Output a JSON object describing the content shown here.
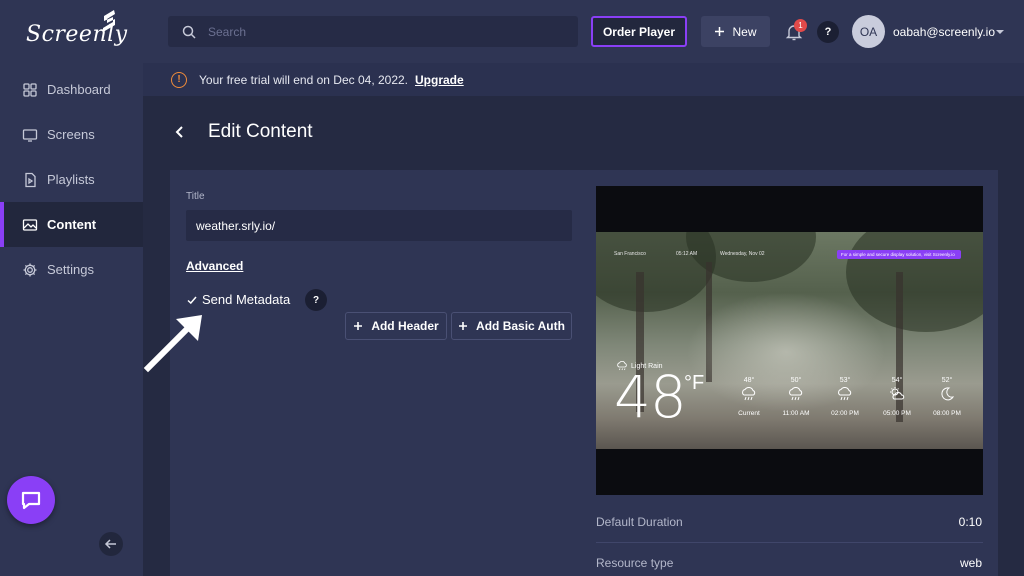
{
  "brand": {
    "name": "Screenly",
    "accent": "#8a3ff6"
  },
  "sidebar": {
    "items": [
      {
        "label": "Dashboard",
        "icon": "grid-icon",
        "active": false
      },
      {
        "label": "Screens",
        "icon": "monitor-icon",
        "active": false
      },
      {
        "label": "Playlists",
        "icon": "playlist-icon",
        "active": false
      },
      {
        "label": "Content",
        "icon": "image-icon",
        "active": true
      },
      {
        "label": "Settings",
        "icon": "gear-icon",
        "active": false
      }
    ]
  },
  "topbar": {
    "search_placeholder": "Search",
    "order_label": "Order Player",
    "new_label": "New",
    "notification_count": "1",
    "help_label": "?",
    "avatar_initials": "OA",
    "user_email": "oabah@screenly.io"
  },
  "banner": {
    "message": "Your free trial will end on Dec 04, 2022.",
    "link": "Upgrade",
    "color": "#f08c3a"
  },
  "page": {
    "title": "Edit Content"
  },
  "form": {
    "title_label": "Title",
    "title_value": "weather.srly.io/",
    "advanced_label": "Advanced",
    "metadata_label": "Send Metadata",
    "metadata_checked": true,
    "help_label": "?",
    "add_header_label": "Add Header",
    "add_auth_label": "Add Basic Auth"
  },
  "preview": {
    "location": "San Francisco",
    "time": "05:12 AM",
    "date": "Wednesday, Nov 02",
    "promo": "For a simple and secure display solution, visit Screenly.io",
    "condition": "Light Rain",
    "temperature": "48",
    "unit": "°F",
    "forecast": [
      {
        "temp": "48°",
        "label": "Current",
        "icon": "rain-icon"
      },
      {
        "temp": "50°",
        "label": "11:00 AM",
        "icon": "rain-icon"
      },
      {
        "temp": "53°",
        "label": "02:00 PM",
        "icon": "rain-icon"
      },
      {
        "temp": "54°",
        "label": "05:00 PM",
        "icon": "partly-cloudy-icon"
      },
      {
        "temp": "52°",
        "label": "08:00 PM",
        "icon": "moon-icon"
      }
    ]
  },
  "info": {
    "duration_label": "Default Duration",
    "duration_value": "0:10",
    "type_label": "Resource type",
    "type_value": "web"
  }
}
